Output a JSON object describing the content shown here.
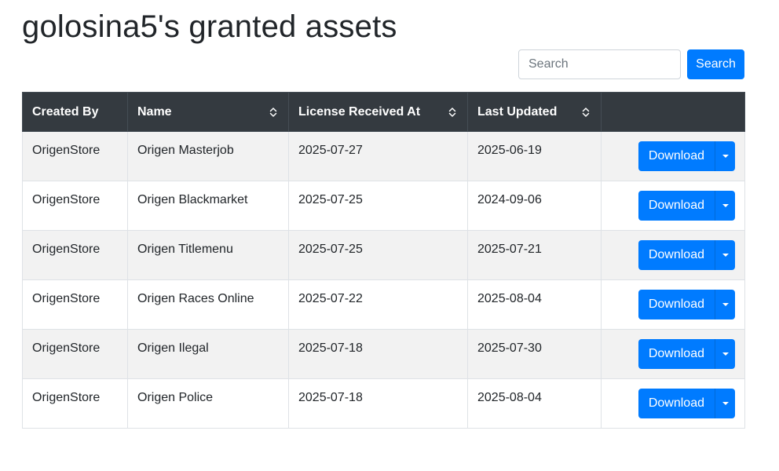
{
  "page": {
    "title": "golosina5's granted assets"
  },
  "search": {
    "placeholder": "Search",
    "button_label": "Search"
  },
  "table": {
    "columns": [
      {
        "label": "Created By",
        "sortable": false
      },
      {
        "label": "Name",
        "sortable": true
      },
      {
        "label": "License Received At",
        "sortable": true
      },
      {
        "label": "Last Updated",
        "sortable": true
      },
      {
        "label": "",
        "sortable": false
      }
    ],
    "rows": [
      {
        "created_by": "OrigenStore",
        "name": "Origen Masterjob",
        "license_received_at": "2025-07-27",
        "last_updated": "2025-06-19",
        "action": "Download"
      },
      {
        "created_by": "OrigenStore",
        "name": "Origen Blackmarket",
        "license_received_at": "2025-07-25",
        "last_updated": "2024-09-06",
        "action": "Download"
      },
      {
        "created_by": "OrigenStore",
        "name": "Origen Titlemenu",
        "license_received_at": "2025-07-25",
        "last_updated": "2025-07-21",
        "action": "Download"
      },
      {
        "created_by": "OrigenStore",
        "name": "Origen Races Online",
        "license_received_at": "2025-07-22",
        "last_updated": "2025-08-04",
        "action": "Download"
      },
      {
        "created_by": "OrigenStore",
        "name": "Origen Ilegal",
        "license_received_at": "2025-07-18",
        "last_updated": "2025-07-30",
        "action": "Download"
      },
      {
        "created_by": "OrigenStore",
        "name": "Origen Police",
        "license_received_at": "2025-07-18",
        "last_updated": "2025-08-04",
        "action": "Download"
      }
    ]
  },
  "icons": {
    "sort": "sort-icon",
    "dropdown": "caret-down-icon"
  },
  "colors": {
    "primary": "#007bff",
    "header_bg": "#343a40",
    "stripe": "#f2f2f2"
  }
}
